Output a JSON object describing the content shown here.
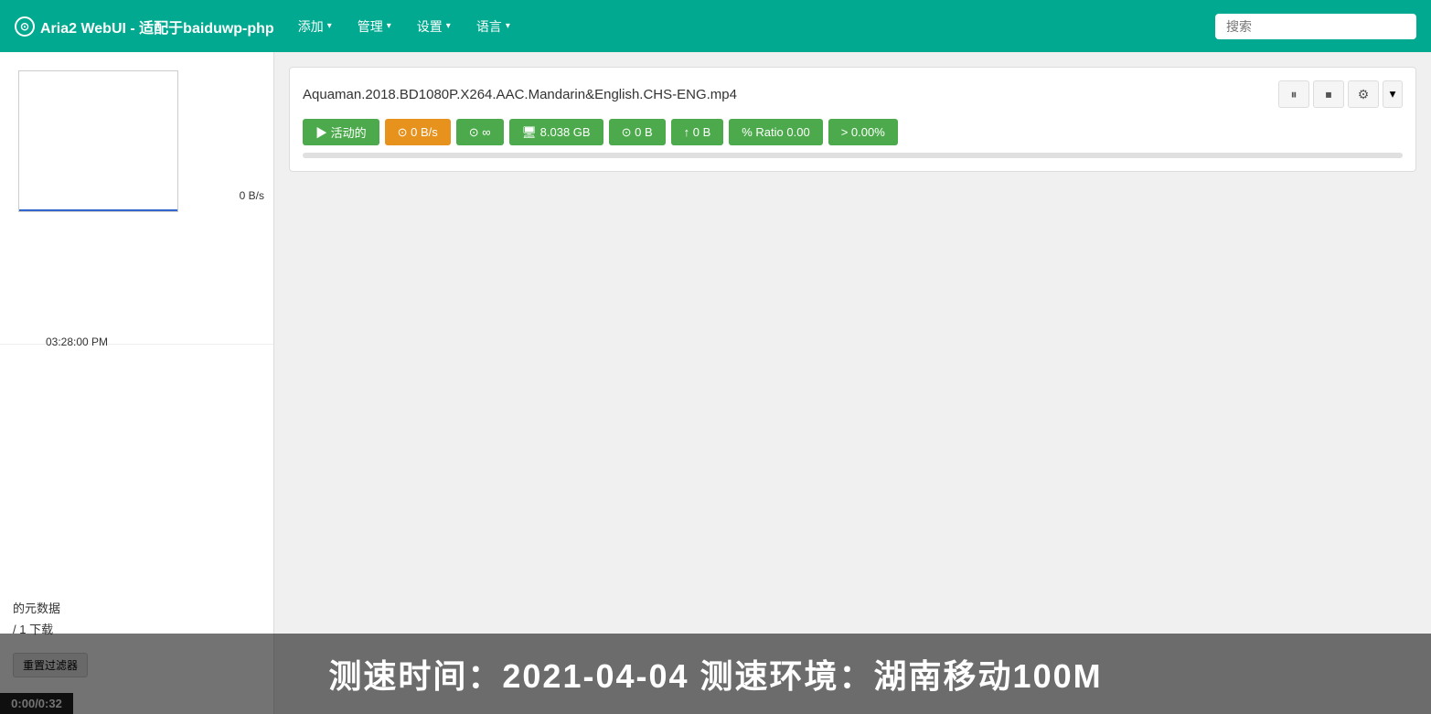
{
  "navbar": {
    "brand": "Aria2 WebUI - 适配于baiduwp-php",
    "logo_symbol": "⊙",
    "add_label": "添加",
    "manage_label": "管理",
    "settings_label": "设置",
    "language_label": "语言",
    "search_placeholder": "搜索"
  },
  "sidebar": {
    "chart_speed": "0 B/s",
    "chart_time": "03:28:00 PM",
    "metadata_label": "的元数据",
    "download_count": "/ 1 下载",
    "reset_filter": "重置过滤器",
    "video_timer": "0:00/0:32"
  },
  "download": {
    "filename": "Aquaman.2018.BD1080P.X264.AAC.Mandarin&English.CHS-ENG.mp4",
    "status_active": "▶ 活动的",
    "speed": "⊙ 0 B/s",
    "connections": "⊙ ∞",
    "size": "🖥 8.038 GB",
    "uploaded": "⊙ 0 B",
    "upload_speed": "↑ 0 B",
    "ratio": "% Ratio 0.00",
    "progress": "> 0.00%",
    "progress_value": 0,
    "actions": {
      "pause_icon": "⏸",
      "stop_icon": "⏹",
      "settings_icon": "⚙",
      "dropdown_icon": "▾"
    }
  },
  "watermark": {
    "text": "测速时间：2021-04-04  测速环境：湖南移动100M"
  }
}
